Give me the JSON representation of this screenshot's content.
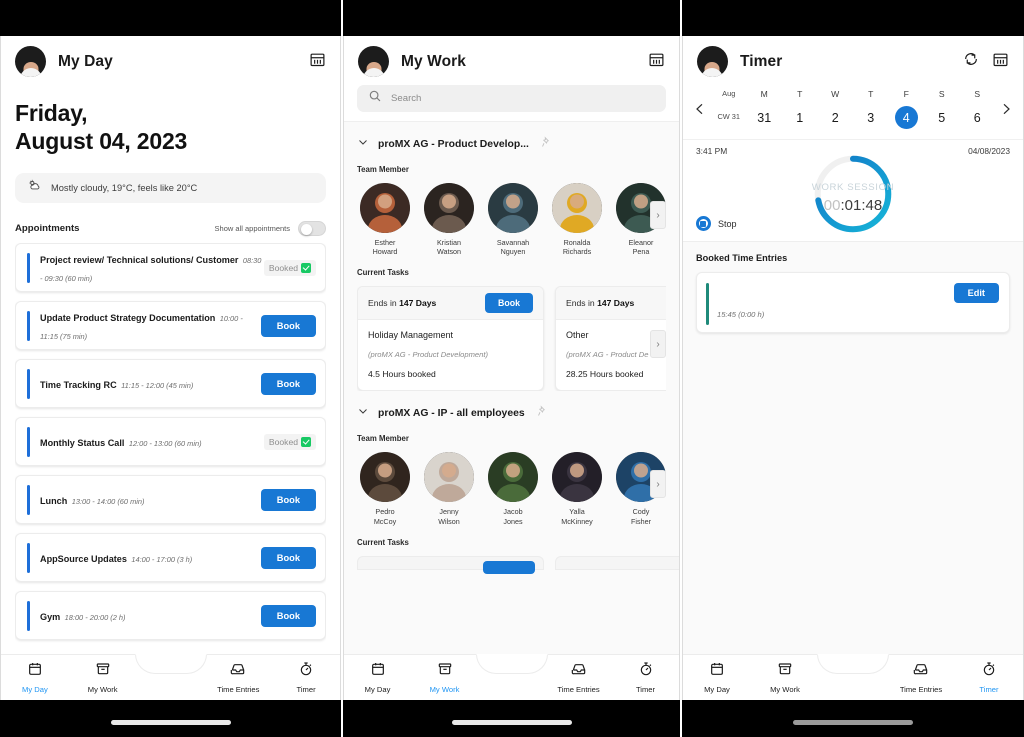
{
  "phones": {
    "my_day": {
      "header": {
        "title": "My Day",
        "calendar_icon": "calendar-icon"
      },
      "date_line1": "Friday,",
      "date_line2": "August 04, 2023",
      "weather": {
        "icon": "partly-cloudy-icon",
        "text": "Mostly cloudy, 19°C, feels like 20°C"
      },
      "appointments_label": "Appointments",
      "show_all_label": "Show all appointments",
      "show_all_on": false,
      "appointments": [
        {
          "title": "Project review/ Technical solutions/ Customer",
          "time": "08:30 - 09:30 (60 min)",
          "state": "booked",
          "booked_label": "Booked",
          "action_label": "Book"
        },
        {
          "title": "Update Product Strategy Documentation",
          "time": "10:00 - 11:15 (75 min)",
          "state": "book",
          "booked_label": "Booked",
          "action_label": "Book"
        },
        {
          "title": "Time Tracking RC",
          "time": "11:15 - 12:00 (45 min)",
          "state": "book",
          "booked_label": "Booked",
          "action_label": "Book"
        },
        {
          "title": "Monthly Status Call",
          "time": "12:00 - 13:00 (60 min)",
          "state": "booked",
          "booked_label": "Booked",
          "action_label": "Book"
        },
        {
          "title": "Lunch",
          "time": "13:00 - 14:00 (60 min)",
          "state": "book",
          "booked_label": "Booked",
          "action_label": "Book"
        },
        {
          "title": "AppSource Updates",
          "time": "14:00 - 17:00 (3 h)",
          "state": "book",
          "booked_label": "Booked",
          "action_label": "Book"
        },
        {
          "title": "Gym",
          "time": "18:00 - 20:00 (2 h)",
          "state": "book",
          "booked_label": "Booked",
          "action_label": "Book"
        }
      ],
      "nav": {
        "active": "My Day",
        "items": [
          {
            "label": "My Day",
            "icon": "calendar-icon"
          },
          {
            "label": "My Work",
            "icon": "archive-box-icon"
          },
          {
            "label": "Time Entries",
            "icon": "inbox-tray-icon"
          },
          {
            "label": "Timer",
            "icon": "stopwatch-icon"
          }
        ]
      }
    },
    "my_work": {
      "header": {
        "title": "My Work",
        "calendar_icon": "calendar-icon"
      },
      "search": {
        "placeholder": "Search",
        "value": "",
        "icon": "search-icon"
      },
      "projects": [
        {
          "name": "proMX AG - Product Develop...",
          "pinned": false,
          "pin_icon": "pin-icon",
          "expanded": true,
          "team_member_label": "Team Member",
          "members": [
            {
              "name": "Esther\nHoward"
            },
            {
              "name": "Kristian\nWatson"
            },
            {
              "name": "Savannah\nNguyen"
            },
            {
              "name": "Ronalda\nRichards"
            },
            {
              "name": "Eleanor\nPena"
            }
          ],
          "current_tasks_label": "Current Tasks",
          "tasks": [
            {
              "ends_prefix": "Ends in ",
              "ends_value": "147 Days",
              "action_label": "Book",
              "name": "Holiday Management",
              "project": "(proMX AG - Product Development)",
              "hours": "4.5 Hours booked"
            },
            {
              "ends_prefix": "Ends in ",
              "ends_value": "147 Days",
              "action_label": "Book",
              "name": "Other",
              "project": "(proMX AG - Product De",
              "hours": "28.25 Hours booked"
            }
          ]
        },
        {
          "name": "proMX AG - IP - all employees",
          "pinned": false,
          "pin_icon": "pin-icon",
          "expanded": true,
          "team_member_label": "Team Member",
          "members": [
            {
              "name": "Pedro\nMcCoy"
            },
            {
              "name": "Jenny\nWilson"
            },
            {
              "name": "Jacob\nJones"
            },
            {
              "name": "Yalla\nMcKinney"
            },
            {
              "name": "Cody\nFisher"
            }
          ],
          "current_tasks_label": "Current Tasks",
          "tasks": []
        }
      ],
      "nav": {
        "active": "My Work",
        "items": [
          {
            "label": "My Day",
            "icon": "calendar-icon"
          },
          {
            "label": "My Work",
            "icon": "archive-box-icon"
          },
          {
            "label": "Time Entries",
            "icon": "inbox-tray-icon"
          },
          {
            "label": "Timer",
            "icon": "stopwatch-icon"
          }
        ]
      }
    },
    "timer": {
      "header": {
        "title": "Timer",
        "refresh_icon": "refresh-icon",
        "calendar_icon": "calendar-icon"
      },
      "calendar": {
        "prev_icon": "chevron-left-icon",
        "next_icon": "chevron-right-icon",
        "month_label": "Aug",
        "week_label": "CW 31",
        "days": [
          {
            "dow": "M",
            "num": "31",
            "selected": false
          },
          {
            "dow": "T",
            "num": "1",
            "selected": false
          },
          {
            "dow": "W",
            "num": "2",
            "selected": false
          },
          {
            "dow": "T",
            "num": "3",
            "selected": false
          },
          {
            "dow": "F",
            "num": "4",
            "selected": true
          },
          {
            "dow": "S",
            "num": "5",
            "selected": false
          },
          {
            "dow": "S",
            "num": "6",
            "selected": false
          }
        ]
      },
      "session": {
        "start_time": "3:41 PM",
        "date": "04/08/2023",
        "ring_label": "WORK SESSION",
        "elapsed_dim": "00",
        "elapsed_rest": ":01:48",
        "elapsed_full": "00:01:48",
        "progress_pct": 72,
        "stop_label": "Stop",
        "stop_icon": "stop-icon"
      },
      "booked_entries_label": "Booked Time Entries",
      "entries": [
        {
          "time": "15:45 (0:00 h)",
          "edit_label": "Edit"
        }
      ],
      "nav": {
        "active": "Timer",
        "items": [
          {
            "label": "My Day",
            "icon": "calendar-icon"
          },
          {
            "label": "My Work",
            "icon": "archive-box-icon"
          },
          {
            "label": "Time Entries",
            "icon": "inbox-tray-icon"
          },
          {
            "label": "Timer",
            "icon": "stopwatch-icon"
          }
        ]
      }
    }
  },
  "colors": {
    "accent_blue": "#1878d4",
    "nav_active": "#2196f3",
    "booked_green": "#18c964",
    "ring_blue": "#0f73c4",
    "ring_cyan": "#16b6d8",
    "entry_teal": "#1f8a7a"
  }
}
